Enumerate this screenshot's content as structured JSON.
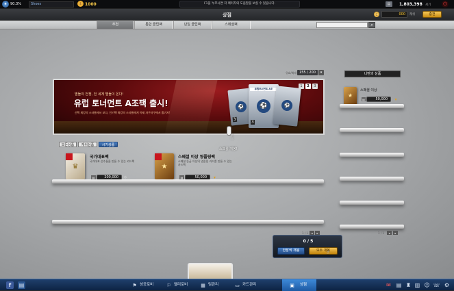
{
  "topbar": {
    "level_percent": "90.3%",
    "server_name": "Shoes",
    "coins": "1000",
    "notice": "F1을 누르시면 각 페이지의 도움말을 보실 수 있습니다.",
    "money": "1,803,398",
    "money_unit": "세기"
  },
  "titlebar": {
    "title": "상점",
    "cash_amount": "000",
    "cash_unit": "캐쉬",
    "charge_label": "충전"
  },
  "nav": {
    "tabs": [
      "추천",
      "통합 클럽팩",
      "단일 클럽팩",
      "스페셜팩"
    ],
    "active_index": 0,
    "search_placeholder": ""
  },
  "banner": {
    "counter": "155 / 200",
    "counter_label": "유효/최대",
    "subtitle": "별들의 전쟁, 전 세계 별들이 온다!",
    "headline": "유럽 토너먼트 A조팩 출시!",
    "description": "선택 최강의 스타들에서 보다, 인기팩 최강의 스타들에게 이제 자구자구에서 즐기자!",
    "pack_label": "유럽토너먼트 A조",
    "pack_count": "3",
    "pages": [
      "1",
      "2",
      "3"
    ],
    "active_page": 2
  },
  "scroll_hint": "스크롤 개봉!",
  "filters": {
    "items": [
      "모든상품",
      "캐쉬상품",
      "시기상품"
    ],
    "active_index": 2
  },
  "products": [
    {
      "name": "국가대표팩",
      "desc": "국가대표 선수들을 만들 수 있는 카드팩",
      "price": "200,000"
    },
    {
      "name": "스페셜 이상 영플링팩",
      "desc": "스페셜 등급 이상의 영플링 카드를 만들 수 있는 카드팩",
      "price": "50,000"
    }
  ],
  "pagination": {
    "text": "1 / 1"
  },
  "my_items": {
    "title": "나만의 상품",
    "items": [
      {
        "name": "스페셜 이상",
        "price": "50,000"
      }
    ],
    "pagination": "1 / 1"
  },
  "open_popup": {
    "count": "0 / 5",
    "single_open": "한장씩 개봉",
    "open_all": "모두 개봉"
  },
  "bottombar": {
    "tabs": [
      "성공로비",
      "랠리로비",
      "팀관리",
      "카드관리",
      "상점"
    ],
    "active_index": 4
  },
  "colors": {
    "accent_blue": "#2b5690",
    "banner_red": "#7a0f12",
    "gold": "#e0a020",
    "bottombar": "#0d2444"
  }
}
